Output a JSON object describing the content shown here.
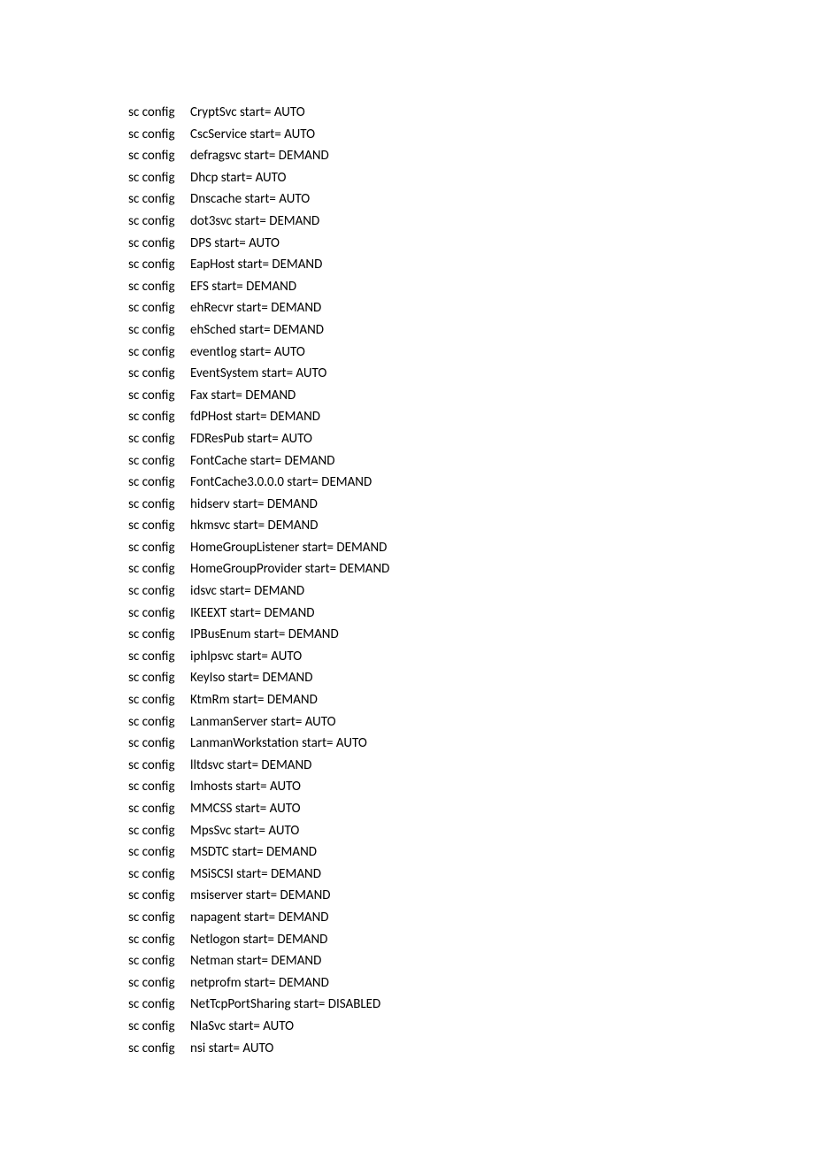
{
  "lines": [
    {
      "cmd": "sc config",
      "rest": "CryptSvc start= AUTO"
    },
    {
      "cmd": "sc config",
      "rest": "CscService start= AUTO"
    },
    {
      "cmd": "sc config",
      "rest": "defragsvc start= DEMAND"
    },
    {
      "cmd": "sc config",
      "rest": "Dhcp start= AUTO"
    },
    {
      "cmd": "sc config",
      "rest": "Dnscache start= AUTO"
    },
    {
      "cmd": "sc config",
      "rest": "dot3svc start= DEMAND"
    },
    {
      "cmd": "sc config",
      "rest": "DPS start= AUTO"
    },
    {
      "cmd": "sc config",
      "rest": "EapHost start= DEMAND"
    },
    {
      "cmd": "sc config",
      "rest": "EFS start= DEMAND"
    },
    {
      "cmd": "sc config",
      "rest": "ehRecvr start= DEMAND"
    },
    {
      "cmd": "sc config",
      "rest": "ehSched start= DEMAND"
    },
    {
      "cmd": "sc config",
      "rest": "eventlog start= AUTO"
    },
    {
      "cmd": "sc config",
      "rest": "EventSystem start= AUTO"
    },
    {
      "cmd": "sc config",
      "rest": "Fax start= DEMAND"
    },
    {
      "cmd": "sc config",
      "rest": "fdPHost start= DEMAND"
    },
    {
      "cmd": "sc config",
      "rest": "FDResPub start= AUTO"
    },
    {
      "cmd": "sc config",
      "rest": "FontCache start= DEMAND"
    },
    {
      "cmd": "sc config",
      "rest": "FontCache3.0.0.0 start= DEMAND"
    },
    {
      "cmd": "sc config",
      "rest": "hidserv start= DEMAND"
    },
    {
      "cmd": "sc config",
      "rest": "hkmsvc start= DEMAND"
    },
    {
      "cmd": "sc config",
      "rest": "HomeGroupListener start= DEMAND"
    },
    {
      "cmd": "sc config",
      "rest": "HomeGroupProvider start= DEMAND"
    },
    {
      "cmd": "sc config",
      "rest": "idsvc start= DEMAND"
    },
    {
      "cmd": "sc config",
      "rest": "IKEEXT start= DEMAND"
    },
    {
      "cmd": "sc config",
      "rest": "IPBusEnum start= DEMAND"
    },
    {
      "cmd": "sc config",
      "rest": "iphlpsvc start= AUTO"
    },
    {
      "cmd": "sc config",
      "rest": "KeyIso start= DEMAND"
    },
    {
      "cmd": "sc config",
      "rest": "KtmRm start= DEMAND"
    },
    {
      "cmd": "sc config",
      "rest": "LanmanServer start= AUTO"
    },
    {
      "cmd": "sc config",
      "rest": "LanmanWorkstation start= AUTO"
    },
    {
      "cmd": "sc config",
      "rest": "lltdsvc start= DEMAND"
    },
    {
      "cmd": "sc config",
      "rest": "lmhosts start= AUTO"
    },
    {
      "cmd": "sc config",
      "rest": "MMCSS start= AUTO"
    },
    {
      "cmd": "sc config",
      "rest": "MpsSvc start= AUTO"
    },
    {
      "cmd": "sc config",
      "rest": "MSDTC start= DEMAND"
    },
    {
      "cmd": "sc config",
      "rest": "MSiSCSI start= DEMAND"
    },
    {
      "cmd": "sc config",
      "rest": "msiserver start= DEMAND"
    },
    {
      "cmd": "sc config",
      "rest": "napagent start= DEMAND"
    },
    {
      "cmd": "sc config",
      "rest": "Netlogon start= DEMAND"
    },
    {
      "cmd": "sc config",
      "rest": "Netman start= DEMAND"
    },
    {
      "cmd": "sc config",
      "rest": "netprofm start= DEMAND"
    },
    {
      "cmd": "sc config",
      "rest": "NetTcpPortSharing start= DISABLED"
    },
    {
      "cmd": "sc config",
      "rest": "NlaSvc start= AUTO"
    },
    {
      "cmd": "sc config",
      "rest": "nsi start= AUTO"
    }
  ]
}
